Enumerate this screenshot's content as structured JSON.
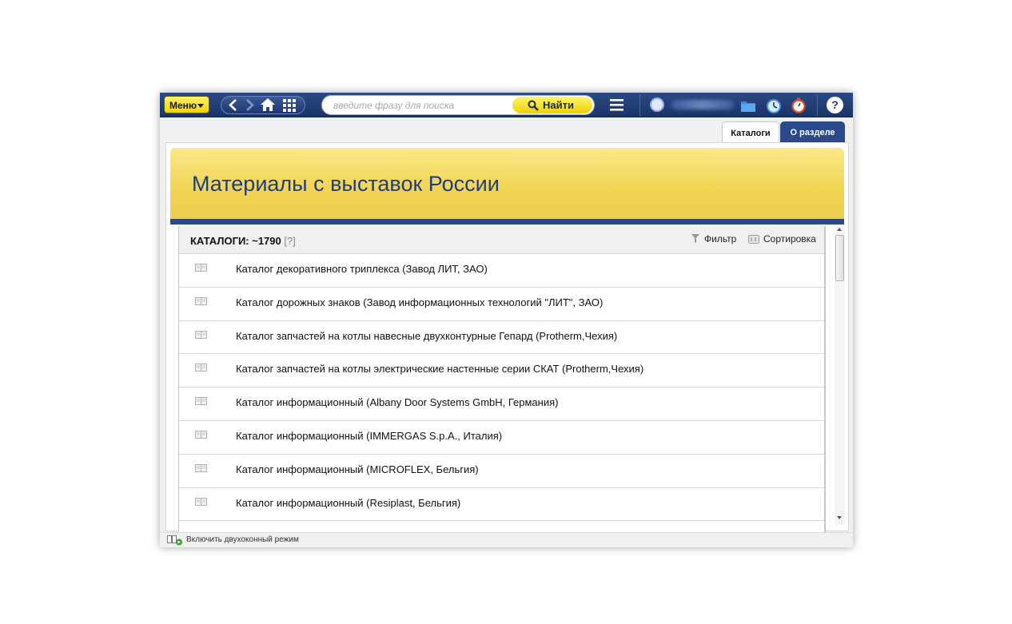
{
  "toolbar": {
    "menu_label": "Меню",
    "search_placeholder": "введите фразу для поиска",
    "find_label": "Найти",
    "help_label": "?"
  },
  "tabs": {
    "catalogs": "Каталоги",
    "about": "О разделе"
  },
  "banner": {
    "title": "Материалы с выставок России"
  },
  "panel": {
    "heading": "КАТАЛОГИ: ~1790",
    "heading_help": "[?]",
    "filter_label": "Фильтр",
    "sort_label": "Сортировка"
  },
  "items": [
    "Каталог декоративного триплекса (Завод ЛИТ, ЗАО)",
    "Каталог дорожных знаков (Завод информационных технологий \"ЛИТ\", ЗАО)",
    "Каталог запчастей на котлы навесные двухконтурные Гепард (Protherm,Чехия)",
    "Каталог запчастей на котлы электрические настенные серии СКАТ (Protherm,Чехия)",
    "Каталог информационный (Albany Door Systems GmbH, Германия)",
    "Каталог информационный (IMMERGAS S.p.A., Италия)",
    "Каталог информационный (MICROFLEX, Бельгия)",
    "Каталог информационный (Resiplast, Бельгия)"
  ],
  "status": {
    "dual_window_label": "Включить двухоконный режим"
  },
  "colors": {
    "toolbar_bg": "#1f3a72",
    "accent_yellow": "#f3d400",
    "title_blue": "#213d7a",
    "tab_active_bg": "#2a4a8c"
  }
}
